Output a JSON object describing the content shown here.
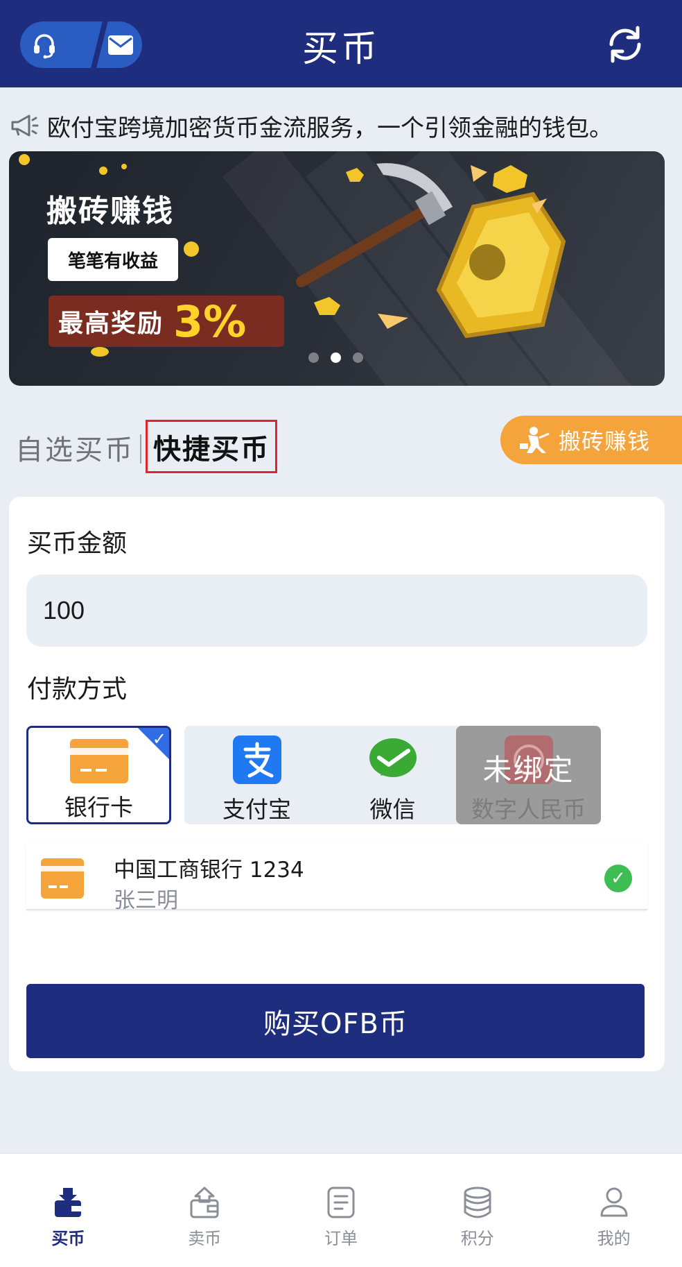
{
  "header": {
    "title": "买币",
    "support_icon": "headset-icon",
    "mail_icon": "mail-icon",
    "refresh_icon": "refresh-icon"
  },
  "notice": {
    "icon": "megaphone-icon",
    "text": "欧付宝跨境加密货币金流服务，一个引领金融的钱包。"
  },
  "banner": {
    "title": "搬砖赚钱",
    "pill": "笔笔有收益",
    "reward_label": "最高奖励",
    "reward_value": "3%",
    "active_dot": 1,
    "dot_count": 3
  },
  "tabs": {
    "items": [
      "自选买币",
      "快捷买币"
    ],
    "active": "快捷买币"
  },
  "earn_button": {
    "label": "搬砖赚钱",
    "icon": "worker-icon"
  },
  "form": {
    "amount_label": "买币金额",
    "amount_value": "100",
    "payment_label": "付款方式",
    "payment_methods": [
      {
        "label": "银行卡",
        "icon": "bank-card-icon",
        "selected": true
      },
      {
        "label": "支付宝",
        "icon": "alipay-icon",
        "selected": false
      },
      {
        "label": "微信",
        "icon": "wechat-icon",
        "selected": false
      },
      {
        "label": "数字人民币",
        "icon": "digital-rmb-icon",
        "selected": false,
        "overlay": "未绑定"
      }
    ],
    "bank_account": {
      "name": "中国工商银行 1234",
      "holder": "张三明"
    },
    "buy_button": "购买OFB币"
  },
  "bottom_nav": [
    {
      "label": "买币",
      "icon": "buy-coin-icon",
      "active": true
    },
    {
      "label": "卖币",
      "icon": "sell-coin-icon",
      "active": false
    },
    {
      "label": "订单",
      "icon": "order-icon",
      "active": false
    },
    {
      "label": "积分",
      "icon": "points-icon",
      "active": false
    },
    {
      "label": "我的",
      "icon": "profile-icon",
      "active": false
    }
  ],
  "colors": {
    "primary": "#1e2d7d",
    "accent": "#2b5cc1",
    "orange": "#f4a43a",
    "success": "#3dbd52",
    "background": "#e9eef5"
  }
}
